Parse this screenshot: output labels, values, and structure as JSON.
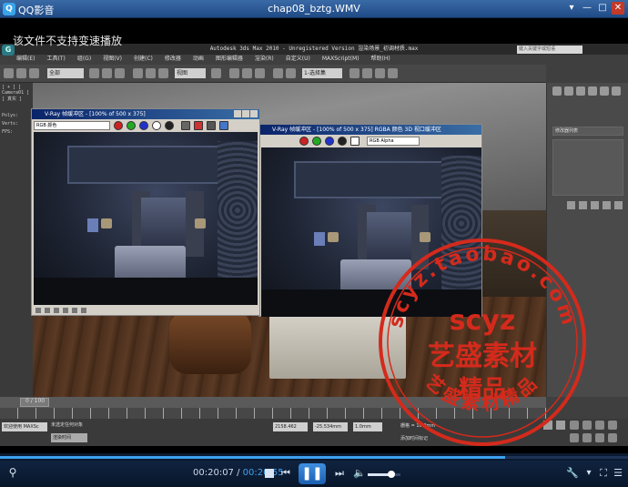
{
  "player": {
    "app_name": "QQ影音",
    "file_title": "chap08_bztg.WMV",
    "notice": "该文件不支持变速播放",
    "window_buttons": [
      "▾",
      "—",
      "□",
      "✕"
    ],
    "current_time": "00:20:07",
    "total_time": "00:20:55",
    "time_separator": "/",
    "progress_fraction": 0.805,
    "volume_fraction": 0.72,
    "accent_color": "#3fa0f0",
    "controls": {
      "stop_icon": "stop-icon",
      "prev_icon": "previous-icon",
      "pause_icon": "pause-icon",
      "next_icon": "next-icon",
      "volume_icon": "volume-icon",
      "tools_icon": "wrench-icon",
      "fullscreen_icon": "fullscreen-icon"
    }
  },
  "max": {
    "title": "Autodesk 3ds Max 2010 - Unregistered Version  渲染场景_初调材质.max",
    "search_placeholder": "键入关键字或短语",
    "menu": [
      "编辑(E)",
      "工具(T)",
      "组(G)",
      "视图(V)",
      "创建(C)",
      "修改器",
      "动画",
      "图形编辑器",
      "渲染(R)",
      "自定义(U)",
      "MAXScript(M)",
      "帮助(H)"
    ],
    "toolbar_combo_1": "全部",
    "toolbar_combo_2": "视图",
    "toolbar_combo_3": "1-选择集",
    "viewport_label": "[ + ] [ Camera01 ] [ 真实 ]",
    "stats": [
      "Polys:",
      "Verts:",
      "FPS:"
    ],
    "cmd_combo": "修改器列表",
    "time_label": "0 / 100",
    "status_left": "欢迎使用 MAXSc",
    "status_render": "渲染时间",
    "status_select": "未选定任何对象",
    "coord_x": "2158.462",
    "coord_y": "-25.534mm",
    "coord_z": "1.0mm",
    "grid": "栅格 = 10.0mm",
    "add_tag": "添加时间标记"
  },
  "vfb_left": {
    "title": "V-Ray 帧缓冲区 - [100% of 500 x 375]",
    "channel": "RGB 颜色"
  },
  "vfb_right": {
    "title": "V-Ray 帧缓冲区 - [100% of 500 x 375]  RGBA 颜色 3D 视口缓冲区",
    "channel": "RGB Alpha"
  },
  "watermark": {
    "url": "scyz.taobao.com",
    "brand": "scyz",
    "name": "艺盛素材",
    "sub": "精品",
    "motto": "艺盛素材精品",
    "color": "#d42a1c"
  }
}
